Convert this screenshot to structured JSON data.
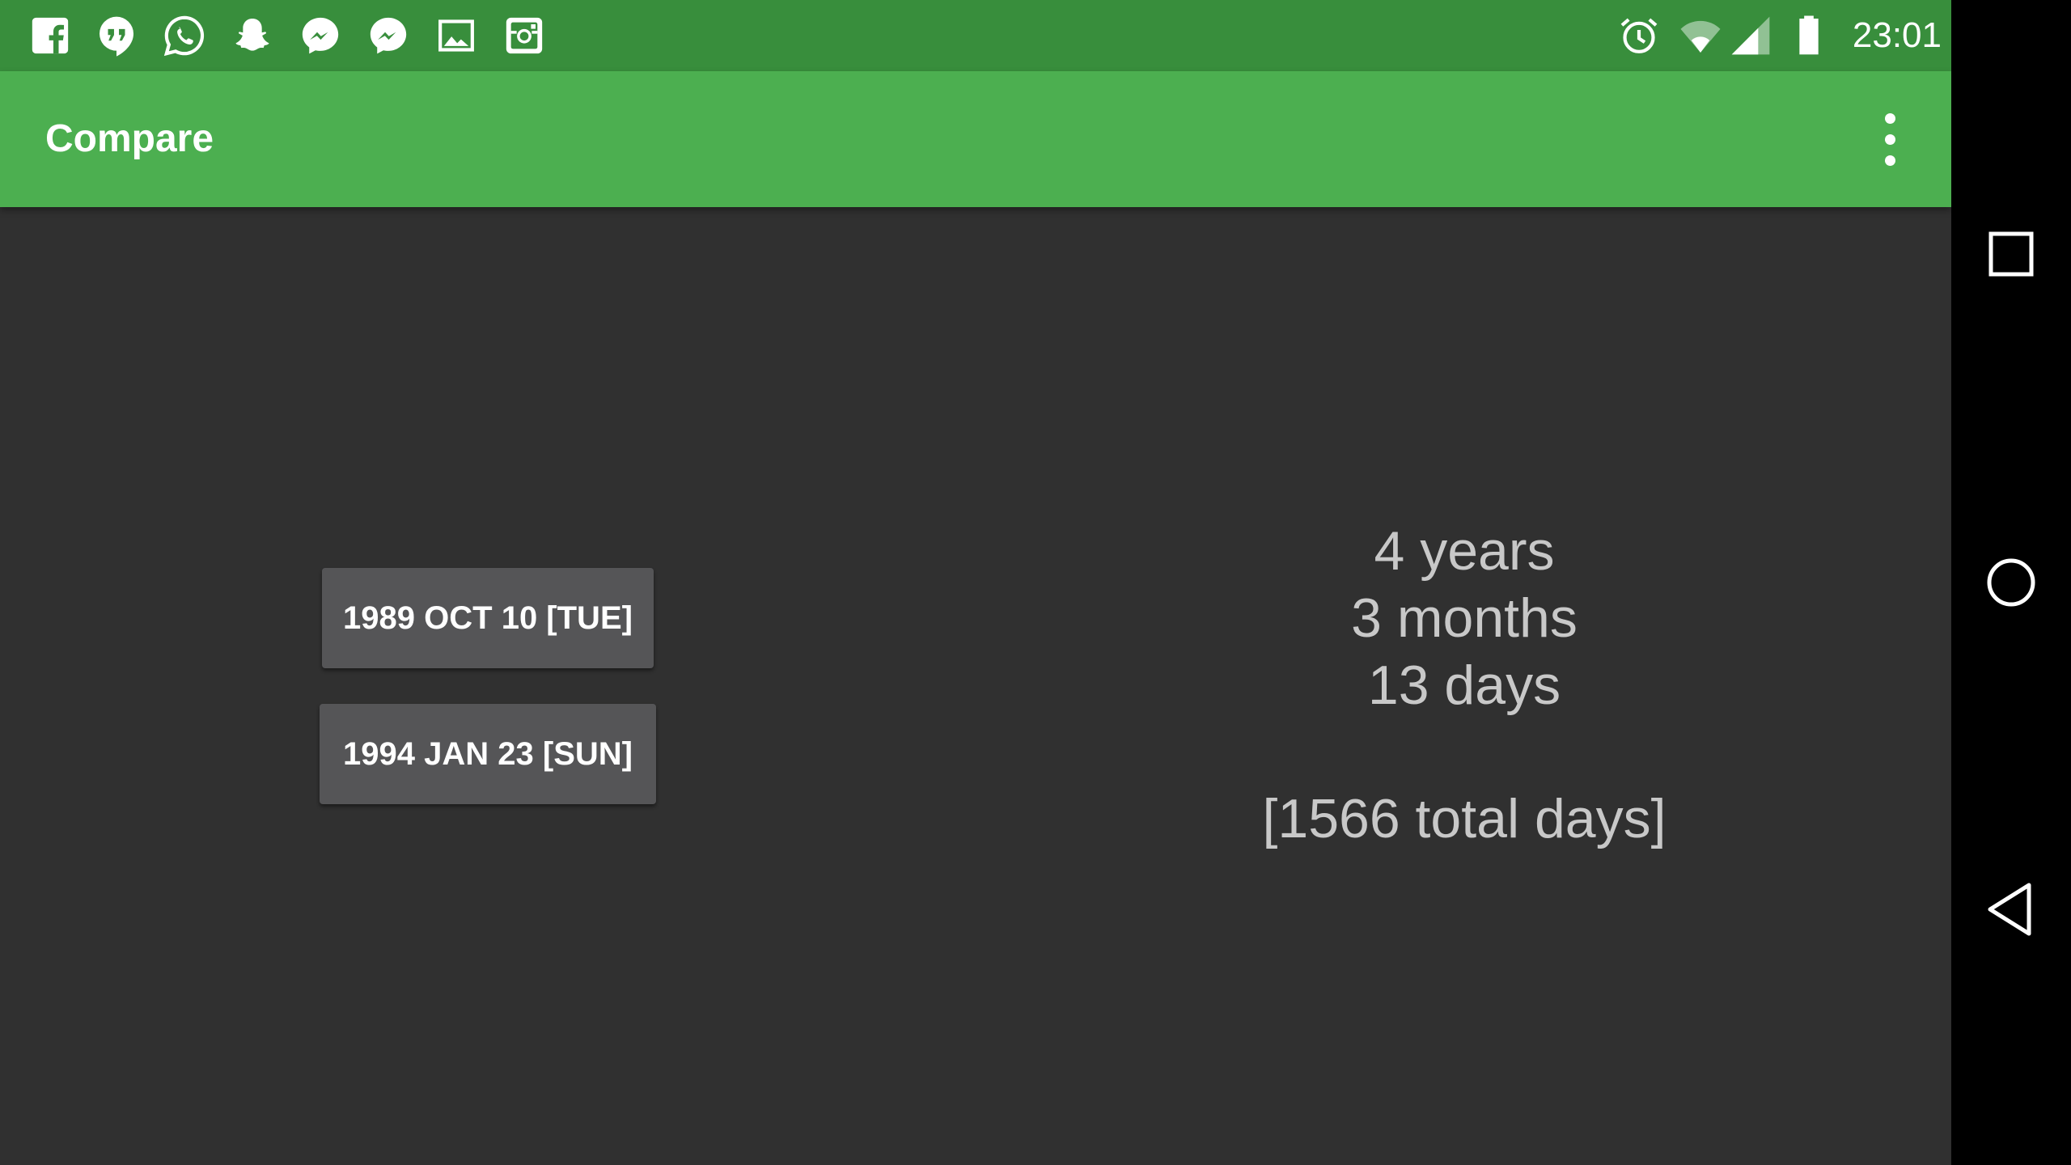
{
  "status_bar": {
    "notification_icons": [
      "facebook-icon",
      "hangouts-icon",
      "whatsapp-icon",
      "snapchat-icon",
      "messenger-icon",
      "messenger-icon",
      "gallery-icon",
      "instagram-icon"
    ],
    "system_icons": [
      "alarm-icon",
      "wifi-icon",
      "cell-signal-icon",
      "battery-icon"
    ],
    "time": "23:01"
  },
  "app_bar": {
    "title": "Compare",
    "menu_icon": "more-vert-icon"
  },
  "main": {
    "start_date": "1989 OCT 10 [TUE]",
    "end_date": "1994 JAN 23 [SUN]",
    "result": {
      "years": "4 years",
      "months": "3 months",
      "days": "13 days",
      "total": "[1566 total days]"
    }
  },
  "nav_bar": {
    "buttons": [
      "recents-icon",
      "home-icon",
      "back-icon"
    ]
  },
  "colors": {
    "status_bar": "#388e3c",
    "app_bar": "#4caf50",
    "background": "#303030",
    "button": "#555557",
    "result_text": "#c8c8c8"
  }
}
